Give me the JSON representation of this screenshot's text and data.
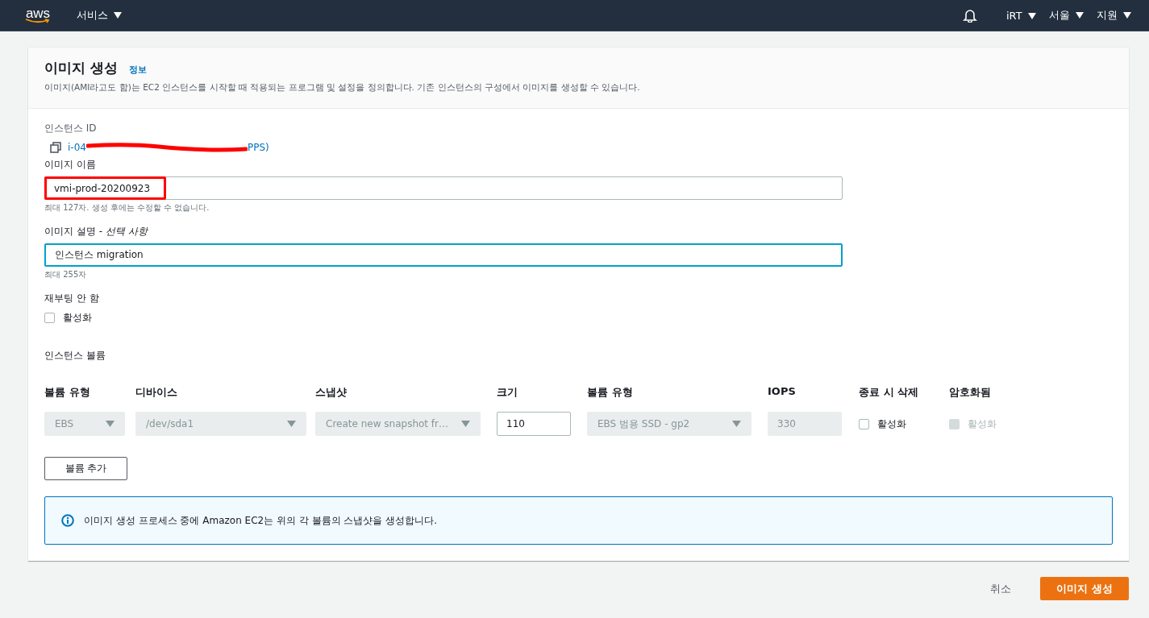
{
  "nav": {
    "logo": "aws",
    "services": "서비스",
    "account": "iRT",
    "region": "서울",
    "support": "지원"
  },
  "header": {
    "title": "이미지 생성",
    "info_link": "정보",
    "description": "이미지(AMI라고도 함)는 EC2 인스턴스를 시작할 때 적용되는 프로그램 및 설정을 정의합니다. 기존 인스턴스의 구성에서 이미지를 생성할 수 있습니다."
  },
  "instance_id": {
    "label": "인스턴스 ID",
    "value_start": "i-04",
    "value_end": "PPS)",
    "redacted": true
  },
  "image_name": {
    "label": "이미지 이름",
    "value": "vmi-prod-20200923",
    "highlighted": true,
    "hint": "최대 127자. 생성 후에는 수정할 수 없습니다."
  },
  "image_description": {
    "label": "이미지 설명 - ",
    "optional": "선택 사항",
    "value": "인스턴스 migration",
    "focused": true,
    "hint": "최대 255자"
  },
  "no_reboot": {
    "label": "재부팅 안 함",
    "checkbox": "활성화",
    "checked": false
  },
  "volumes": {
    "title": "인스턴스 볼륨",
    "columns": [
      "볼륨 유형",
      "디바이스",
      "스냅샷",
      "크기",
      "볼륨 유형",
      "IOPS",
      "종료 시 삭제",
      "암호화됨"
    ],
    "row": [
      {
        "kind": "select",
        "value": "EBS",
        "disabled": true
      },
      {
        "kind": "select",
        "value": "/dev/sda1",
        "disabled": true
      },
      {
        "kind": "select",
        "value": "Create new snapshot fr…",
        "disabled": true
      },
      {
        "kind": "input",
        "value": "110",
        "disabled": false
      },
      {
        "kind": "select",
        "value": "EBS 범용 SSD - gp2",
        "disabled": true
      },
      {
        "kind": "input",
        "value": "330",
        "disabled": true
      },
      {
        "kind": "checkbox",
        "value": "활성화",
        "checked": false,
        "disabled": false
      },
      {
        "kind": "checkbox",
        "value": "활성화",
        "checked": false,
        "disabled": true
      }
    ],
    "add_button": "볼륨 추가"
  },
  "info_alert": "이미지 생성 프로세스 중에 Amazon EC2는 위의 각 볼륨의 스냅샷을 생성합니다.",
  "footer": {
    "cancel": "취소",
    "submit": "이미지 생성"
  }
}
